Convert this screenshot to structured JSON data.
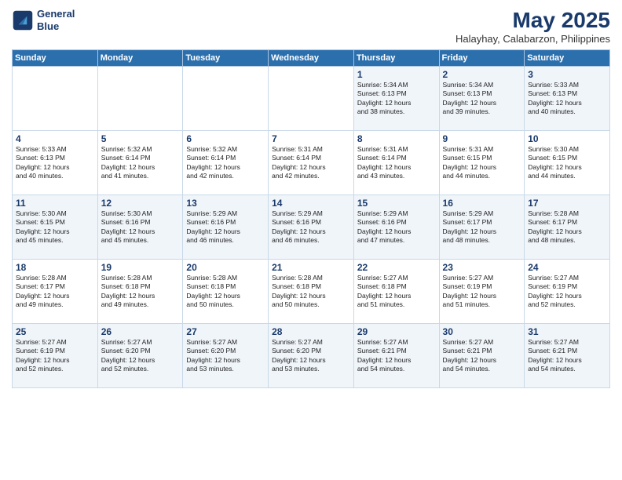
{
  "header": {
    "logo_line1": "General",
    "logo_line2": "Blue",
    "month_year": "May 2025",
    "location": "Halayhay, Calabarzon, Philippines"
  },
  "days_of_week": [
    "Sunday",
    "Monday",
    "Tuesday",
    "Wednesday",
    "Thursday",
    "Friday",
    "Saturday"
  ],
  "weeks": [
    [
      {
        "day": "",
        "info": ""
      },
      {
        "day": "",
        "info": ""
      },
      {
        "day": "",
        "info": ""
      },
      {
        "day": "",
        "info": ""
      },
      {
        "day": "1",
        "info": "Sunrise: 5:34 AM\nSunset: 6:13 PM\nDaylight: 12 hours\nand 38 minutes."
      },
      {
        "day": "2",
        "info": "Sunrise: 5:34 AM\nSunset: 6:13 PM\nDaylight: 12 hours\nand 39 minutes."
      },
      {
        "day": "3",
        "info": "Sunrise: 5:33 AM\nSunset: 6:13 PM\nDaylight: 12 hours\nand 40 minutes."
      }
    ],
    [
      {
        "day": "4",
        "info": "Sunrise: 5:33 AM\nSunset: 6:13 PM\nDaylight: 12 hours\nand 40 minutes."
      },
      {
        "day": "5",
        "info": "Sunrise: 5:32 AM\nSunset: 6:14 PM\nDaylight: 12 hours\nand 41 minutes."
      },
      {
        "day": "6",
        "info": "Sunrise: 5:32 AM\nSunset: 6:14 PM\nDaylight: 12 hours\nand 42 minutes."
      },
      {
        "day": "7",
        "info": "Sunrise: 5:31 AM\nSunset: 6:14 PM\nDaylight: 12 hours\nand 42 minutes."
      },
      {
        "day": "8",
        "info": "Sunrise: 5:31 AM\nSunset: 6:14 PM\nDaylight: 12 hours\nand 43 minutes."
      },
      {
        "day": "9",
        "info": "Sunrise: 5:31 AM\nSunset: 6:15 PM\nDaylight: 12 hours\nand 44 minutes."
      },
      {
        "day": "10",
        "info": "Sunrise: 5:30 AM\nSunset: 6:15 PM\nDaylight: 12 hours\nand 44 minutes."
      }
    ],
    [
      {
        "day": "11",
        "info": "Sunrise: 5:30 AM\nSunset: 6:15 PM\nDaylight: 12 hours\nand 45 minutes."
      },
      {
        "day": "12",
        "info": "Sunrise: 5:30 AM\nSunset: 6:16 PM\nDaylight: 12 hours\nand 45 minutes."
      },
      {
        "day": "13",
        "info": "Sunrise: 5:29 AM\nSunset: 6:16 PM\nDaylight: 12 hours\nand 46 minutes."
      },
      {
        "day": "14",
        "info": "Sunrise: 5:29 AM\nSunset: 6:16 PM\nDaylight: 12 hours\nand 46 minutes."
      },
      {
        "day": "15",
        "info": "Sunrise: 5:29 AM\nSunset: 6:16 PM\nDaylight: 12 hours\nand 47 minutes."
      },
      {
        "day": "16",
        "info": "Sunrise: 5:29 AM\nSunset: 6:17 PM\nDaylight: 12 hours\nand 48 minutes."
      },
      {
        "day": "17",
        "info": "Sunrise: 5:28 AM\nSunset: 6:17 PM\nDaylight: 12 hours\nand 48 minutes."
      }
    ],
    [
      {
        "day": "18",
        "info": "Sunrise: 5:28 AM\nSunset: 6:17 PM\nDaylight: 12 hours\nand 49 minutes."
      },
      {
        "day": "19",
        "info": "Sunrise: 5:28 AM\nSunset: 6:18 PM\nDaylight: 12 hours\nand 49 minutes."
      },
      {
        "day": "20",
        "info": "Sunrise: 5:28 AM\nSunset: 6:18 PM\nDaylight: 12 hours\nand 50 minutes."
      },
      {
        "day": "21",
        "info": "Sunrise: 5:28 AM\nSunset: 6:18 PM\nDaylight: 12 hours\nand 50 minutes."
      },
      {
        "day": "22",
        "info": "Sunrise: 5:27 AM\nSunset: 6:18 PM\nDaylight: 12 hours\nand 51 minutes."
      },
      {
        "day": "23",
        "info": "Sunrise: 5:27 AM\nSunset: 6:19 PM\nDaylight: 12 hours\nand 51 minutes."
      },
      {
        "day": "24",
        "info": "Sunrise: 5:27 AM\nSunset: 6:19 PM\nDaylight: 12 hours\nand 52 minutes."
      }
    ],
    [
      {
        "day": "25",
        "info": "Sunrise: 5:27 AM\nSunset: 6:19 PM\nDaylight: 12 hours\nand 52 minutes."
      },
      {
        "day": "26",
        "info": "Sunrise: 5:27 AM\nSunset: 6:20 PM\nDaylight: 12 hours\nand 52 minutes."
      },
      {
        "day": "27",
        "info": "Sunrise: 5:27 AM\nSunset: 6:20 PM\nDaylight: 12 hours\nand 53 minutes."
      },
      {
        "day": "28",
        "info": "Sunrise: 5:27 AM\nSunset: 6:20 PM\nDaylight: 12 hours\nand 53 minutes."
      },
      {
        "day": "29",
        "info": "Sunrise: 5:27 AM\nSunset: 6:21 PM\nDaylight: 12 hours\nand 54 minutes."
      },
      {
        "day": "30",
        "info": "Sunrise: 5:27 AM\nSunset: 6:21 PM\nDaylight: 12 hours\nand 54 minutes."
      },
      {
        "day": "31",
        "info": "Sunrise: 5:27 AM\nSunset: 6:21 PM\nDaylight: 12 hours\nand 54 minutes."
      }
    ]
  ]
}
